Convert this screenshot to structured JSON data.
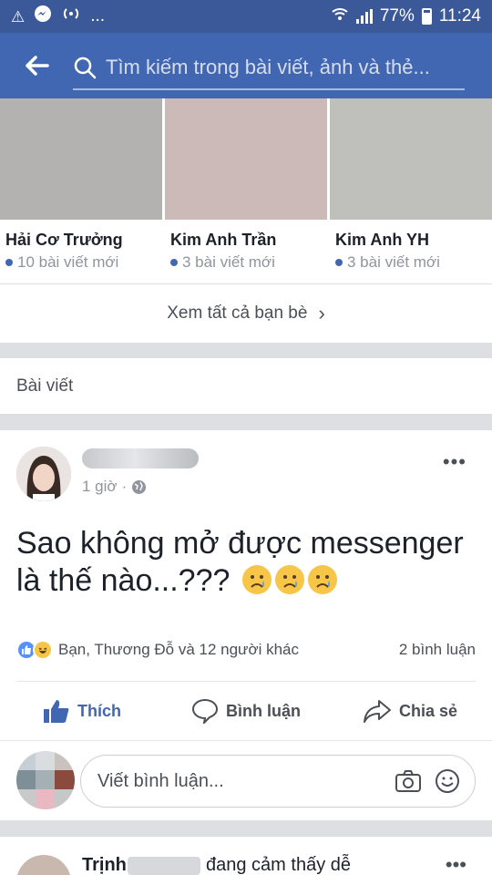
{
  "status_bar": {
    "battery_text": "77%",
    "time": "11:24",
    "ellipsis": "...",
    "battery_level": 0.77
  },
  "header": {
    "search_placeholder": "Tìm kiếm trong bài viết, ảnh và thẻ..."
  },
  "friends": {
    "items": [
      {
        "name": "Hải Cơ Trưởng",
        "count": "10 bài viết mới",
        "photo_color": "#b4b1b1"
      },
      {
        "name": "Kim Anh Trần",
        "count": "3 bài viết mới",
        "photo_color": "#ccbab9"
      },
      {
        "name": "Kim Anh YH",
        "count": "3 bài viết mới",
        "photo_color": "#bfbfbb"
      }
    ],
    "see_all": "Xem tất cả bạn bè"
  },
  "posts_section": {
    "title": "Bài viết"
  },
  "post": {
    "time": "1 giờ",
    "text_line1": "Sao không mở được messenger",
    "text_line2": "là thế nào...???",
    "reactions_text": "Bạn, Thương Đỗ và 12 người khác",
    "comments_text": "2 bình luận",
    "actions": {
      "like": "Thích",
      "comment": "Bình luận",
      "share": "Chia sẻ"
    },
    "comment_placeholder": "Viết bình luận..."
  },
  "next_post": {
    "name_start": "Trịnh",
    "rest": "đang      cảm thấy dễ"
  },
  "colors": {
    "brand": "#4267b2",
    "status_bar": "#3b5998"
  }
}
